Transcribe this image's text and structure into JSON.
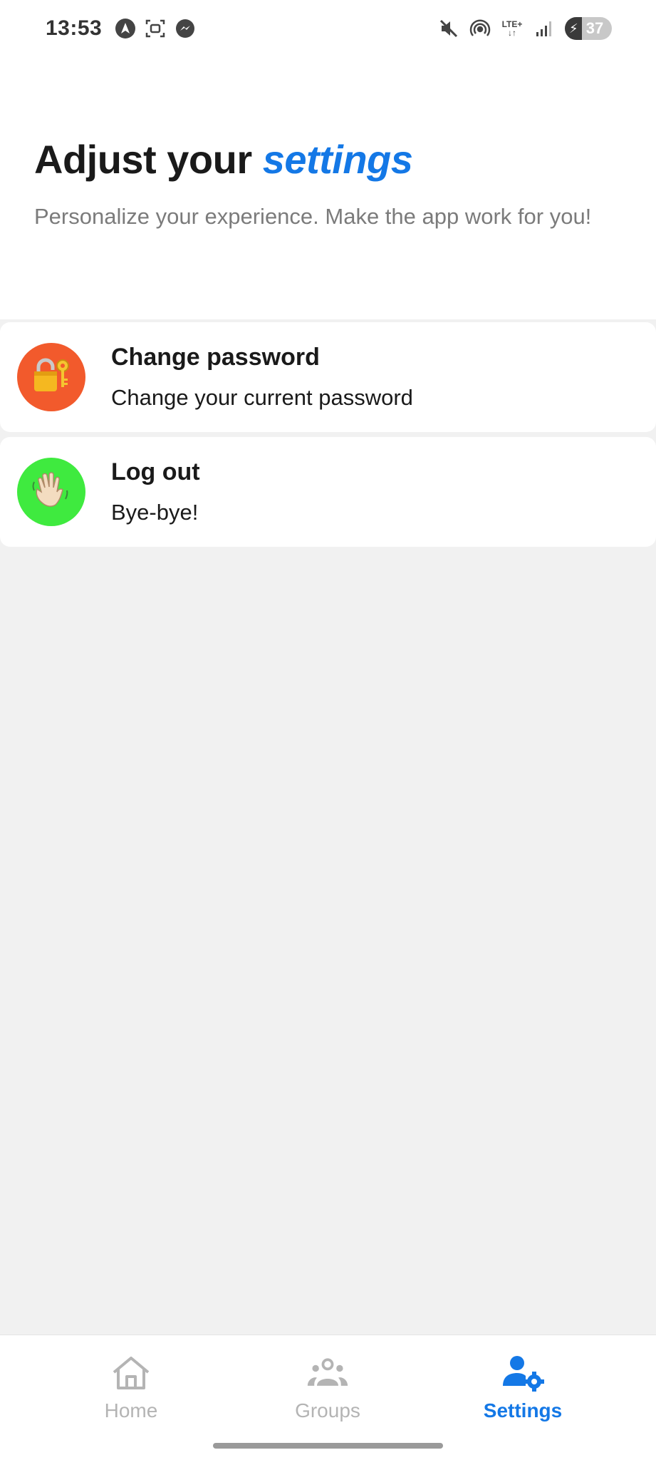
{
  "status_bar": {
    "time": "13:53",
    "network": "LTE+",
    "battery_percent": "37",
    "battery_level": 0.37
  },
  "header": {
    "title_prefix": "Adjust your",
    "title_accent": "settings",
    "subtitle": "Personalize your experience. Make the app work for you!"
  },
  "options": [
    {
      "title": "Change password",
      "subtitle": "Change your current password",
      "icon": "lock-with-key-icon",
      "icon_bg": "#f25a2c"
    },
    {
      "title": "Log out",
      "subtitle": "Bye-bye!",
      "icon": "waving-hand-icon",
      "icon_bg": "#3fea3f"
    }
  ],
  "bottom_nav": {
    "items": [
      {
        "label": "Home",
        "icon": "home-icon",
        "active": false
      },
      {
        "label": "Groups",
        "icon": "groups-icon",
        "active": false
      },
      {
        "label": "Settings",
        "icon": "user-settings-icon",
        "active": true
      }
    ]
  },
  "colors": {
    "accent": "#1478e6",
    "background": "#f1f1f1",
    "inactive_nav": "#b4b4b4"
  }
}
